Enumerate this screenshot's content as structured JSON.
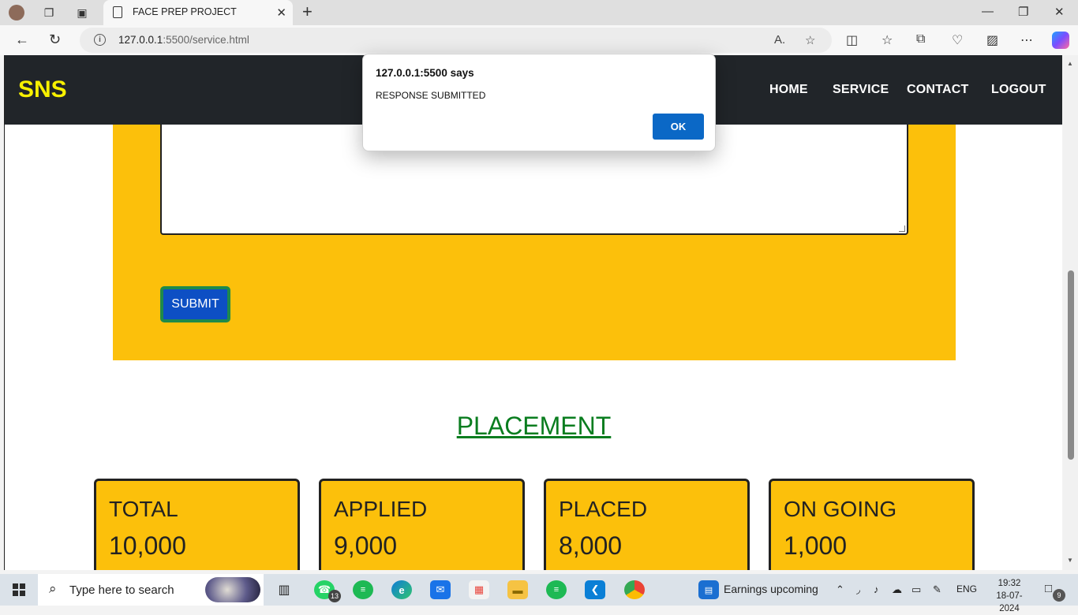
{
  "browser": {
    "tab_title": "FACE PREP PROJECT",
    "url_host": "127.0.0.1",
    "url_rest": ":5500/service.html"
  },
  "site": {
    "brand": "SNS",
    "nav": [
      "HOME",
      "SERVICE",
      "CONTACT",
      "LOGOUT"
    ],
    "submit_label": "SUBMIT",
    "placement_title": "PLACEMENT",
    "stats": [
      {
        "label": "TOTAL",
        "value": "10,000"
      },
      {
        "label": "APPLIED",
        "value": "9,000"
      },
      {
        "label": "PLACED",
        "value": "8,000"
      },
      {
        "label": "ON GOING",
        "value": "1,000"
      }
    ]
  },
  "alert": {
    "title": "127.0.0.1:5500 says",
    "message": "RESPONSE SUBMITTED",
    "ok_label": "OK"
  },
  "taskbar": {
    "search_placeholder": "Type here to search",
    "whatsapp_badge": "13",
    "news_text": "Earnings upcoming",
    "language": "ENG",
    "time": "19:32",
    "date": "18-07-2024",
    "notification_count": "9"
  }
}
